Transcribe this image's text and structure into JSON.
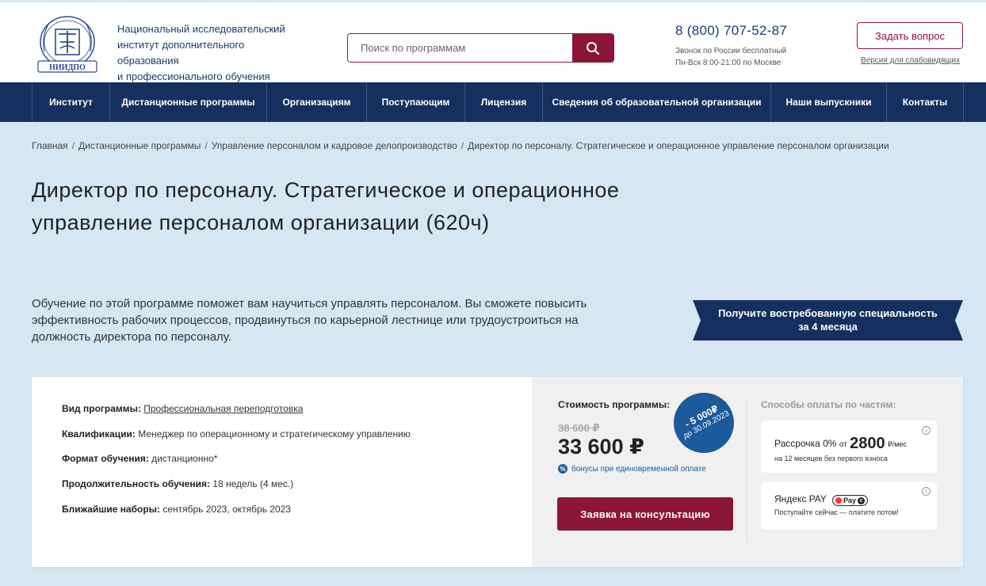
{
  "header": {
    "logo_text": "НИИДПО",
    "institute_lines": [
      "Национальный исследовательский",
      "институт дополнительного образования",
      "и профессионального обучения"
    ],
    "search_placeholder": "Поиск по программам",
    "phone": "8 (800) 707-52-87",
    "phone_note_1": "Звонок по России бесплатный",
    "phone_note_2": "Пн-Вск 8:00-21:00 по Москве",
    "ask_button": "Задать вопрос",
    "a11y_link": "Версия для слабовидящих"
  },
  "nav": {
    "items": [
      {
        "label": "Институт"
      },
      {
        "label": "Дистанционные программы"
      },
      {
        "label": "Организациям"
      },
      {
        "label": "Поступающим"
      },
      {
        "label": "Лицензия"
      },
      {
        "label": "Сведения об образовательной организации"
      },
      {
        "label": "Наши выпускники"
      },
      {
        "label": "Контакты"
      }
    ]
  },
  "breadcrumb": {
    "items": [
      "Главная",
      "Дистанционные программы",
      "Управление персоналом и кадровое делопроизводство",
      "Директор по персоналу. Стратегическое и операционное управление персоналом организации"
    ],
    "separator": "/"
  },
  "page": {
    "title": "Директор по персоналу. Стратегическое и операционное управление персоналом организации (620ч)",
    "lead": "Обучение по этой программе поможет вам научиться управлять персоналом. Вы сможете повысить эффективность рабочих процессов, продвинуться по карьерной лестнице или трудоустроиться на должность директора по персоналу.",
    "ribbon_line1": "Получите востребованную специальность",
    "ribbon_line2": "за 4 месяца"
  },
  "program": {
    "type_label": "Вид программы:",
    "type_value": "Профессиональная переподготовка",
    "qual_label": "Квалификации:",
    "qual_value": "Менеджер по операционному и стратегическому управлению",
    "format_label": "Формат обучения:",
    "format_value": "дистанционно*",
    "duration_label": "Продолжительность обучения:",
    "duration_value": "18 недель (4 мес.)",
    "intake_label": "Ближайшие наборы:",
    "intake_value": "сентябрь 2023, октябрь 2023"
  },
  "price": {
    "label": "Стоимость программы:",
    "old": "38 600 ₽",
    "new": "33 600 ₽",
    "discount_amount": "- 5 000₽",
    "discount_until": "до 30.09.2023",
    "bonus_icon": "%",
    "bonus_text": "бонусы при единовременной оплате",
    "consult_button": "Заявка на консультацию"
  },
  "payment": {
    "title": "Способы оплаты по частям:",
    "installment_prefix": "Рассрочка 0%",
    "installment_from": "от",
    "installment_amount": "2800",
    "installment_unit": "₽/мес",
    "installment_note": "на 12 месяцев без первого взноса",
    "yandex_label": "Яндекс PAY",
    "yandex_badge": "Pay",
    "yandex_note": "Поступайте сейчас — платите потом!",
    "info_glyph": "i"
  },
  "colors": {
    "brand_red": "#8b1538",
    "nav_blue": "#14305f",
    "accent_blue": "#1d5a9c",
    "page_bg": "#d6e6f2"
  }
}
